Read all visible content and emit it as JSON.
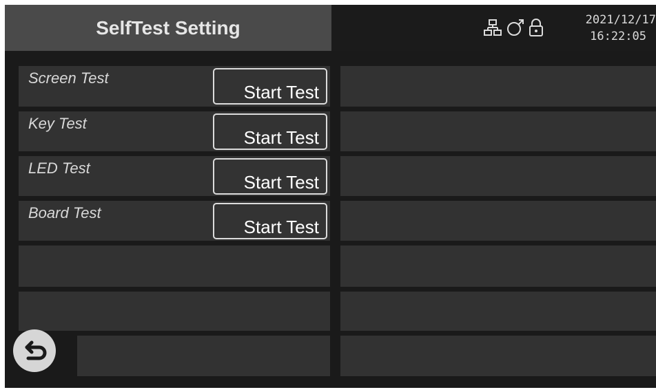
{
  "header": {
    "title": "SelfTest Setting",
    "date": "2021/12/17",
    "time": "16:22:05",
    "status_icons": [
      "network-icon",
      "usb-icon",
      "lock-icon"
    ]
  },
  "tests": [
    {
      "label": "Screen Test",
      "button": "Start Test"
    },
    {
      "label": "Key Test",
      "button": "Start Test"
    },
    {
      "label": "LED Test",
      "button": "Start Test"
    },
    {
      "label": "Board Test",
      "button": "Start Test"
    }
  ],
  "footer": {
    "back_icon": "back-arrow-icon"
  },
  "colors": {
    "background": "#000000",
    "panel": "#323232",
    "header_left": "#4a4a4a",
    "text": "#e6e6e6"
  }
}
